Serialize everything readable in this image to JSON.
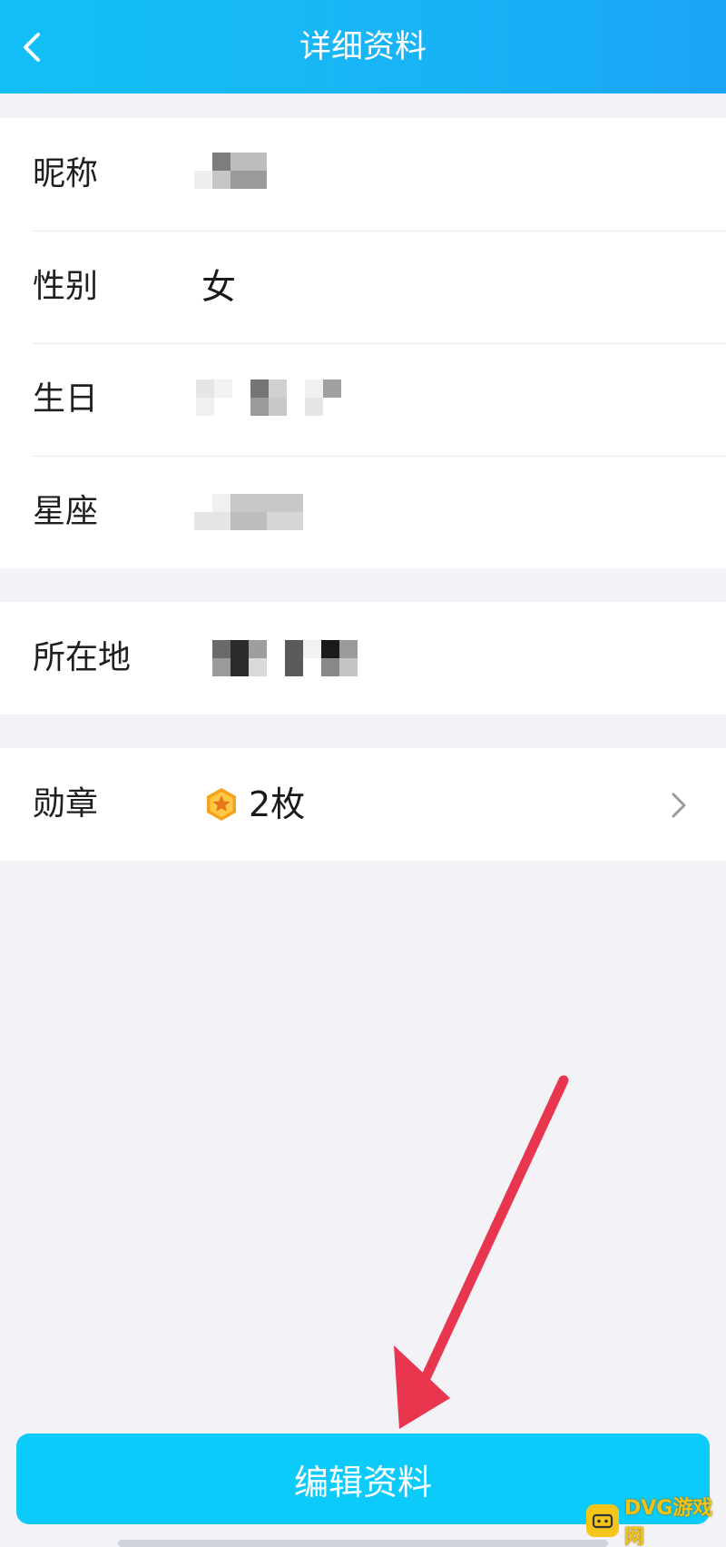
{
  "header": {
    "title": "详细资料",
    "back_icon": "chevron-left-icon"
  },
  "basic_info": [
    {
      "label": "昵称",
      "value": ""
    },
    {
      "label": "性别",
      "value": "女"
    },
    {
      "label": "生日",
      "value": ""
    },
    {
      "label": "星座",
      "value": ""
    }
  ],
  "location": {
    "label": "所在地",
    "value": ""
  },
  "medals": {
    "label": "勋章",
    "icon": "star-medal-icon",
    "count_text": "2枚"
  },
  "edit_button": {
    "label": "编辑资料"
  },
  "watermark": {
    "text": "DVG游戏网"
  },
  "colors": {
    "header": "#18b6f6",
    "button": "#0ccbfb",
    "background": "#f2f2f7",
    "arrow": "#e8364f"
  }
}
